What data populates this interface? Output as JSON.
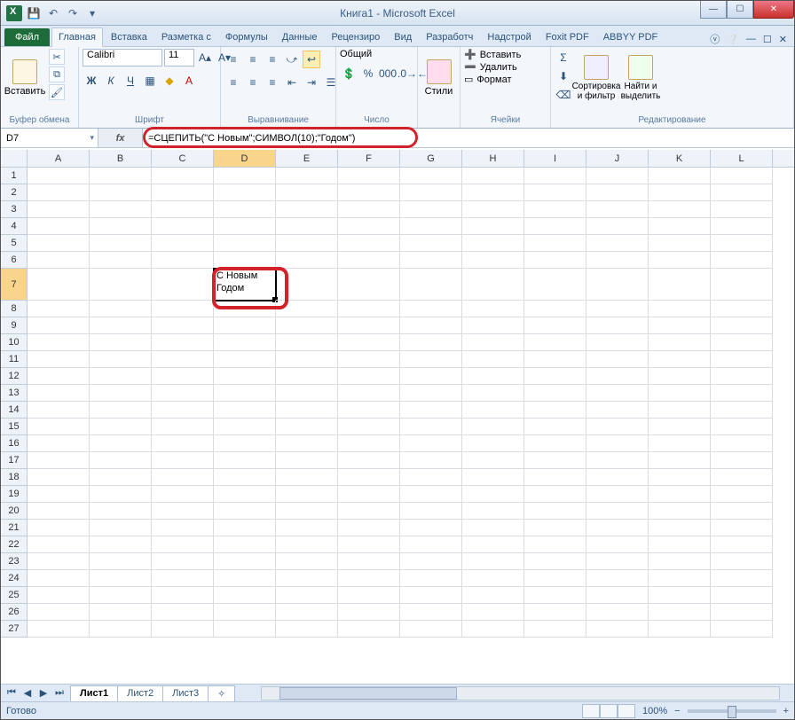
{
  "title": "Книга1 - Microsoft Excel",
  "file_tab": "Файл",
  "tabs": [
    "Главная",
    "Вставка",
    "Разметка с",
    "Формулы",
    "Данные",
    "Рецензиро",
    "Вид",
    "Разработч",
    "Надстрой",
    "Foxit PDF",
    "ABBYY PDF"
  ],
  "active_tab": 0,
  "ribbon": {
    "clipboard": {
      "paste": "Вставить",
      "label": "Буфер обмена"
    },
    "font": {
      "name": "Calibri",
      "size": "11",
      "label": "Шрифт"
    },
    "align": {
      "label": "Выравнивание"
    },
    "number": {
      "format": "Общий",
      "label": "Число"
    },
    "styles": {
      "btn": "Стили"
    },
    "cells": {
      "insert": "Вставить",
      "delete": "Удалить",
      "format": "Формат",
      "label": "Ячейки"
    },
    "edit": {
      "sort": "Сортировка и фильтр",
      "find": "Найти и выделить",
      "label": "Редактирование"
    }
  },
  "namebox": "D7",
  "formula": "=СЦЕПИТЬ(\"С Новым\";СИМВОЛ(10);\"Годом\")",
  "columns": [
    "A",
    "B",
    "C",
    "D",
    "E",
    "F",
    "G",
    "H",
    "I",
    "J",
    "K",
    "L"
  ],
  "active_col": "D",
  "rows": 27,
  "active_row": 7,
  "cell_value_line1": "С Новым",
  "cell_value_line2": "Годом",
  "sheets": [
    "Лист1",
    "Лист2",
    "Лист3"
  ],
  "active_sheet": 0,
  "status": "Готово",
  "zoom": "100%"
}
